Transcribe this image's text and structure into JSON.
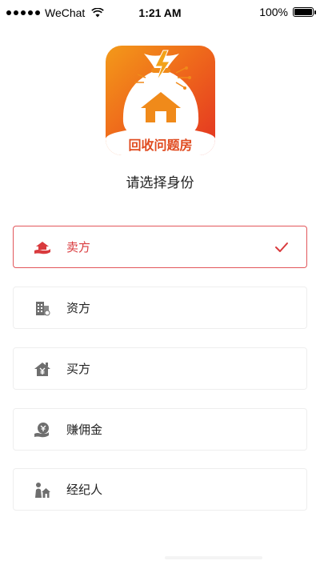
{
  "status_bar": {
    "carrier": "WeChat",
    "time": "1:21 AM",
    "battery": "100%",
    "battery_level": 1.0
  },
  "logo": {
    "caption": "回收问题房",
    "colors": {
      "gradient_start": "#f39a1a",
      "gradient_end": "#e33222",
      "caption_text": "#e04b20"
    }
  },
  "title": "请选择身份",
  "options": [
    {
      "label": "卖方",
      "icon": "house-in-hand-icon",
      "selected": true
    },
    {
      "label": "资方",
      "icon": "building-icon",
      "selected": false
    },
    {
      "label": "买方",
      "icon": "house-yuan-icon",
      "selected": false
    },
    {
      "label": "赚佣金",
      "icon": "coin-hand-icon",
      "selected": false
    },
    {
      "label": "经纪人",
      "icon": "agent-house-icon",
      "selected": false
    }
  ],
  "colors": {
    "accent": "#d93a3d",
    "selected_border": "#e2575b",
    "border": "#eeeeee",
    "icon_gray": "#6e6e6e"
  }
}
